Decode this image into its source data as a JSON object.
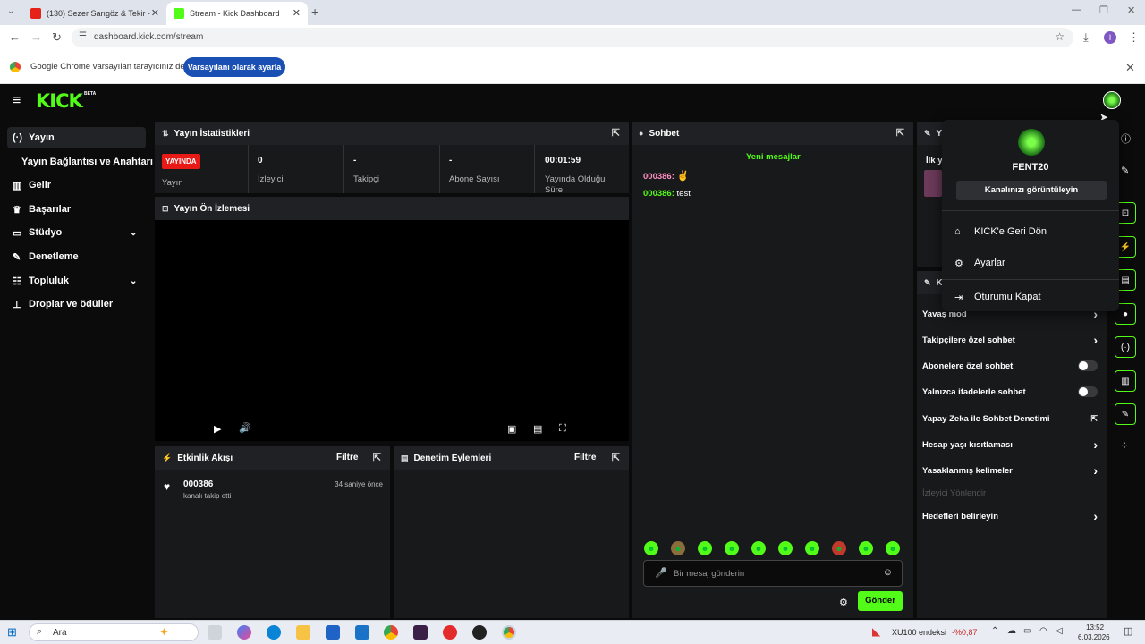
{
  "browser": {
    "tabs": [
      {
        "title": "(130) Sezer Sarıgöz & Tekir - Sa",
        "active": false
      },
      {
        "title": "Stream - Kick Dashboard",
        "active": true
      }
    ],
    "url": "dashboard.kick.com/stream",
    "profile_initial": "I",
    "infobar_text": "Google Chrome varsayılan tarayıcınız değil",
    "infobar_button": "Varsayılanı olarak ayarla"
  },
  "app": {
    "logo": "KICK",
    "logo_badge": "BETA",
    "sidebar": [
      {
        "label": "Yayın",
        "icon": "broadcast-icon"
      },
      {
        "label": "Yayın Bağlantısı ve Anahtarı",
        "icon": ""
      },
      {
        "label": "Gelir",
        "icon": "chart-icon"
      },
      {
        "label": "Başarılar",
        "icon": "trophy-icon"
      },
      {
        "label": "Stüdyo",
        "icon": "studio-icon"
      },
      {
        "label": "Denetleme",
        "icon": "wrench-icon"
      },
      {
        "label": "Topluluk",
        "icon": "community-icon"
      },
      {
        "label": "Droplar ve ödüller",
        "icon": "drops-icon"
      }
    ],
    "stats": {
      "title": "Yayın İstatistikleri",
      "live_badge": "YAYINDA",
      "live_label": "Yayın",
      "items": [
        {
          "value": "0",
          "label": "İzleyici"
        },
        {
          "value": "-",
          "label": "Takipçi"
        },
        {
          "value": "-",
          "label": "Abone Sayısı"
        },
        {
          "value": "00:01:59",
          "label": "Yayında Olduğu Süre"
        }
      ]
    },
    "preview": {
      "title": "Yayın Ön İzlemesi"
    },
    "activity": {
      "title": "Etkinlik Akışı",
      "filter": "Filtre",
      "events": [
        {
          "user": "000386",
          "text": "kanalı takip etti",
          "time": "34 saniye önce"
        }
      ]
    },
    "mod_actions": {
      "title": "Denetim Eylemleri",
      "filter": "Filtre"
    },
    "chat": {
      "title": "Sohbet",
      "new_messages": "Yeni mesajlar",
      "messages": [
        {
          "user": "000386:",
          "text": ""
        },
        {
          "user": "000386:",
          "text": "test"
        }
      ],
      "placeholder": "Bir mesaj gönderin",
      "send": "Gönder",
      "user_color": "#ff8ec1",
      "user_color2": "#53fc18"
    },
    "right_panel": {
      "title_partial": "Ya",
      "first_label": "İlk ya",
      "settings_partial": "Ka",
      "rows": [
        {
          "label": "Yavaş mod",
          "control": "chevron"
        },
        {
          "label": "Takipçilere özel sohbet",
          "control": "chevron"
        },
        {
          "label": "Abonelere özel sohbet",
          "control": "toggle"
        },
        {
          "label": "Yalnızca ifadelerle sohbet",
          "control": "toggle"
        },
        {
          "label": "Yapay Zeka ile Sohbet Denetimi",
          "control": "external"
        },
        {
          "label": "Hesap yaşı kısıtlaması",
          "control": "chevron"
        },
        {
          "label": "Yasaklanmış kelimeler",
          "control": "chevron"
        }
      ],
      "section_label": "İzleyici Yönlendir",
      "goals": "Hedefleri belirleyin"
    },
    "user_menu": {
      "username": "FENT20",
      "view_channel": "Kanalınızı görüntüleyin",
      "items": [
        {
          "label": "KICK'e Geri Dön",
          "icon": "home-icon"
        },
        {
          "label": "Ayarlar",
          "icon": "gear-icon"
        },
        {
          "label": "Oturumu Kapat",
          "icon": "logout-icon"
        }
      ]
    },
    "accent": "#53fc18",
    "live_red": "#e91916"
  },
  "taskbar": {
    "search": "Ara",
    "ticker_name": "XU100 endeksi",
    "ticker_value": "-%0,87",
    "time": "13:52",
    "date": "6.03.2026"
  }
}
